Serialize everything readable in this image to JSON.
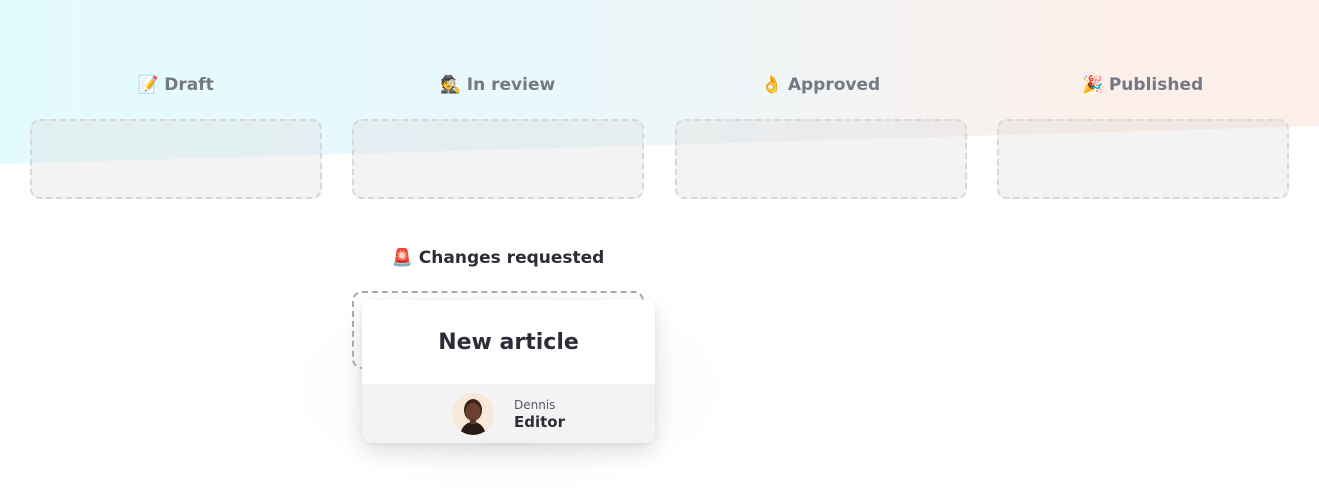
{
  "columns": [
    {
      "emoji": "📝",
      "icon": "memo-icon",
      "label": "Draft"
    },
    {
      "emoji": "🕵️",
      "icon": "detective-icon",
      "label": "In review"
    },
    {
      "emoji": "👌",
      "icon": "ok-hand-icon",
      "label": "Approved"
    },
    {
      "emoji": "🎉",
      "icon": "party-popper-icon",
      "label": "Published"
    }
  ],
  "changes_requested": {
    "emoji": "🚨",
    "icon": "siren-icon",
    "label": "Changes requested"
  },
  "card": {
    "title": "New article",
    "author_name": "Dennis",
    "author_role": "Editor"
  }
}
